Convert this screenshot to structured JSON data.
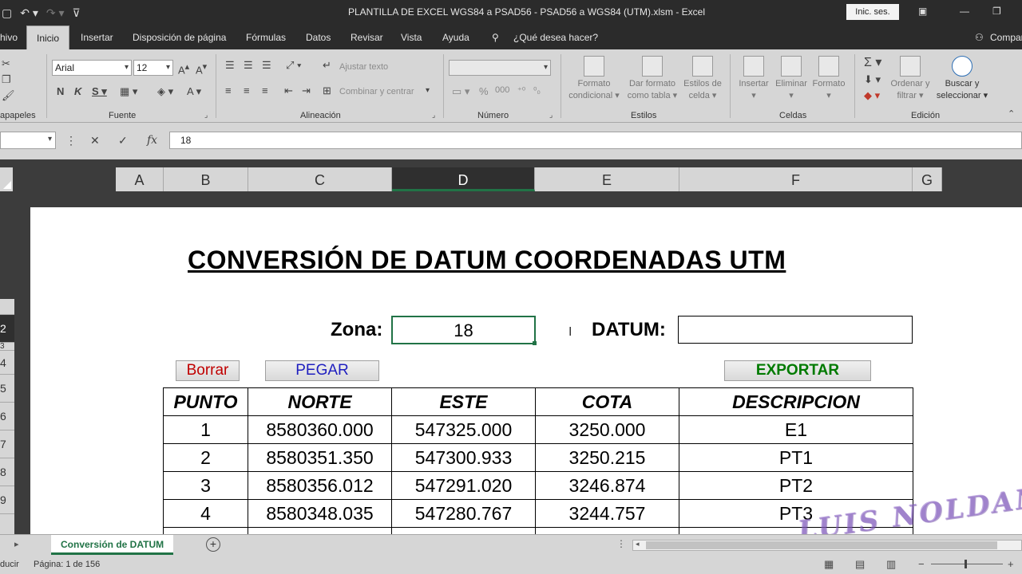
{
  "window": {
    "title": "PLANTILLA DE EXCEL WGS84 a PSAD56 - PSAD56 a WGS84 (UTM).xlsm  -  Excel",
    "signin_label": "Inic. ses."
  },
  "tabs": {
    "file": "hivo",
    "home": "Inicio",
    "insert": "Insertar",
    "layout": "Disposición de página",
    "formulas": "Fórmulas",
    "data": "Datos",
    "review": "Revisar",
    "view": "Vista",
    "help": "Ayuda",
    "tellme": "¿Qué desea hacer?",
    "share": "Compar"
  },
  "ribbon": {
    "clipboard_label": "apapeles",
    "font_label": "Fuente",
    "font_name": "Arial",
    "font_size": "12",
    "alignment_label": "Alineación",
    "wrap_text": "Ajustar texto",
    "merge_center": "Combinar y centrar",
    "number_label": "Número",
    "number_format": "",
    "styles_label": "Estilos",
    "conditional_format": [
      "Formato",
      "condicional"
    ],
    "format_as_table": [
      "Dar formato",
      "como tabla"
    ],
    "cell_styles": [
      "Estilos de",
      "celda"
    ],
    "cells_label": "Celdas",
    "insert": "Insertar",
    "delete": "Eliminar",
    "format": "Formato",
    "editing_label": "Edición",
    "sort_filter": [
      "Ordenar y",
      "filtrar"
    ],
    "find_select": [
      "Buscar y",
      "seleccionar"
    ]
  },
  "formula_bar": {
    "value": "18"
  },
  "columns": [
    "A",
    "B",
    "C",
    "D",
    "E",
    "F",
    "G"
  ],
  "rows": [
    "2",
    "3",
    "4",
    "5",
    "6",
    "7",
    "8",
    "9"
  ],
  "sheet": {
    "title": "CONVERSIÓN DE DATUM COORDENADAS UTM",
    "zona_label": "Zona:",
    "zona_value": "18",
    "datum_label": "DATUM:",
    "datum_value": "",
    "borrar": "Borrar",
    "pegar": "PEGAR",
    "exportar": "EXPORTAR",
    "headers": [
      "PUNTO",
      "NORTE",
      "ESTE",
      "COTA",
      "DESCRIPCION"
    ],
    "rows": [
      [
        "1",
        "8580360.000",
        "547325.000",
        "3250.000",
        "E1"
      ],
      [
        "2",
        "8580351.350",
        "547300.933",
        "3250.215",
        "PT1"
      ],
      [
        "3",
        "8580356.012",
        "547291.020",
        "3246.874",
        "PT2"
      ],
      [
        "4",
        "8580348.035",
        "547280.767",
        "3244.757",
        "PT3"
      ]
    ],
    "watermark": "LUIS NOLDAN"
  },
  "sheet_tabs": {
    "active": "Conversión de DATUM"
  },
  "status": {
    "mode": "ducir",
    "page": "Página: 1 de 156"
  }
}
